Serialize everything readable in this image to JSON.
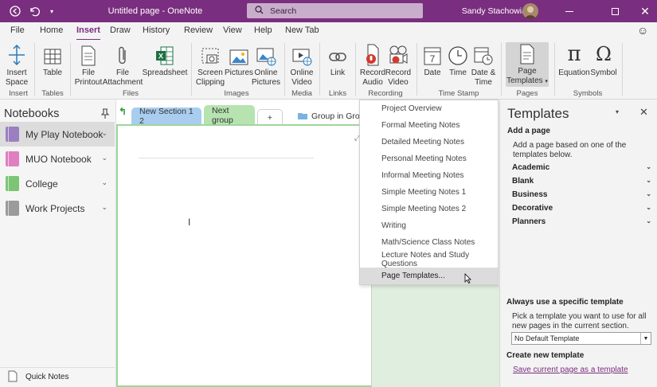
{
  "titlebar": {
    "title": "Untitled page - OneNote",
    "search_placeholder": "Search",
    "user_name": "Sandy Stachowiak"
  },
  "menu": [
    "File",
    "Home",
    "Insert",
    "Draw",
    "History",
    "Review",
    "View",
    "Help",
    "New Tab"
  ],
  "menu_active": "Insert",
  "ribbon": {
    "buttons": [
      {
        "label": "Insert\nSpace",
        "icon": "insert-space-icon"
      },
      {
        "label": "Table",
        "icon": "table-icon"
      },
      {
        "label": "File\nPrintout",
        "icon": "file-printout-icon"
      },
      {
        "label": "File\nAttachment",
        "icon": "attachment-icon"
      },
      {
        "label": "Spreadsheet",
        "icon": "spreadsheet-icon"
      },
      {
        "label": "Screen\nClipping",
        "icon": "screen-clipping-icon"
      },
      {
        "label": "Pictures",
        "icon": "pictures-icon"
      },
      {
        "label": "Online\nPictures",
        "icon": "online-pictures-icon"
      },
      {
        "label": "Online\nVideo",
        "icon": "online-video-icon"
      },
      {
        "label": "Link",
        "icon": "link-icon"
      },
      {
        "label": "Record\nAudio",
        "icon": "record-audio-icon"
      },
      {
        "label": "Record\nVideo",
        "icon": "record-video-icon"
      },
      {
        "label": "Date",
        "icon": "calendar-icon"
      },
      {
        "label": "Time",
        "icon": "clock-icon"
      },
      {
        "label": "Date &\nTime",
        "icon": "date-time-icon"
      },
      {
        "label": "Page\nTemplates",
        "icon": "page-templates-icon"
      },
      {
        "label": "Equation",
        "icon": "equation-icon"
      },
      {
        "label": "Symbol",
        "icon": "symbol-icon"
      }
    ],
    "groups": [
      "Insert",
      "Tables",
      "Files",
      "Images",
      "Media",
      "Links",
      "Recording",
      "Time Stamp",
      "Pages",
      "Symbols"
    ],
    "equation_glyph": "π",
    "symbol_glyph": "Ω"
  },
  "notebooks": {
    "title": "Notebooks",
    "items": [
      {
        "label": "My Play Notebook",
        "color": "#9b7fc0"
      },
      {
        "label": "MUO Notebook",
        "color": "#e07fbf"
      },
      {
        "label": "College",
        "color": "#7cc576"
      },
      {
        "label": "Work Projects",
        "color": "#9b9b9b"
      }
    ],
    "quick_notes": "Quick Notes"
  },
  "sections": {
    "tabs": [
      {
        "label": "New Section 1 2",
        "color": "#a9cdef"
      },
      {
        "label": "Next group",
        "color": "#b6e3b0"
      },
      {
        "label": "+",
        "color": "#ffffff"
      },
      {
        "label": "Group in Group",
        "color": "#ffffff"
      }
    ]
  },
  "template_menu": {
    "items": [
      "Project Overview",
      "Formal Meeting Notes",
      "Detailed Meeting Notes",
      "Personal Meeting Notes",
      "Informal Meeting Notes",
      "Simple Meeting Notes 1",
      "Simple Meeting Notes 2",
      "Writing",
      "Math/Science Class Notes",
      "Lecture Notes and Study Questions"
    ],
    "highlighted": "Page Templates..."
  },
  "templates_pane": {
    "title": "Templates",
    "add_heading": "Add a page",
    "add_desc": "Add a page based on one of the templates below.",
    "categories": [
      "Academic",
      "Blank",
      "Business",
      "Decorative",
      "Planners"
    ],
    "always_heading": "Always use a specific template",
    "always_desc": "Pick a template you want to use for all new pages in the current section.",
    "select_value": "No Default Template",
    "create_heading": "Create new template",
    "save_link": "Save current page as a template"
  },
  "colors": {
    "brand": "#7a2e7f",
    "page_border": "#9fd69b",
    "green_fill": "#dfeede"
  }
}
